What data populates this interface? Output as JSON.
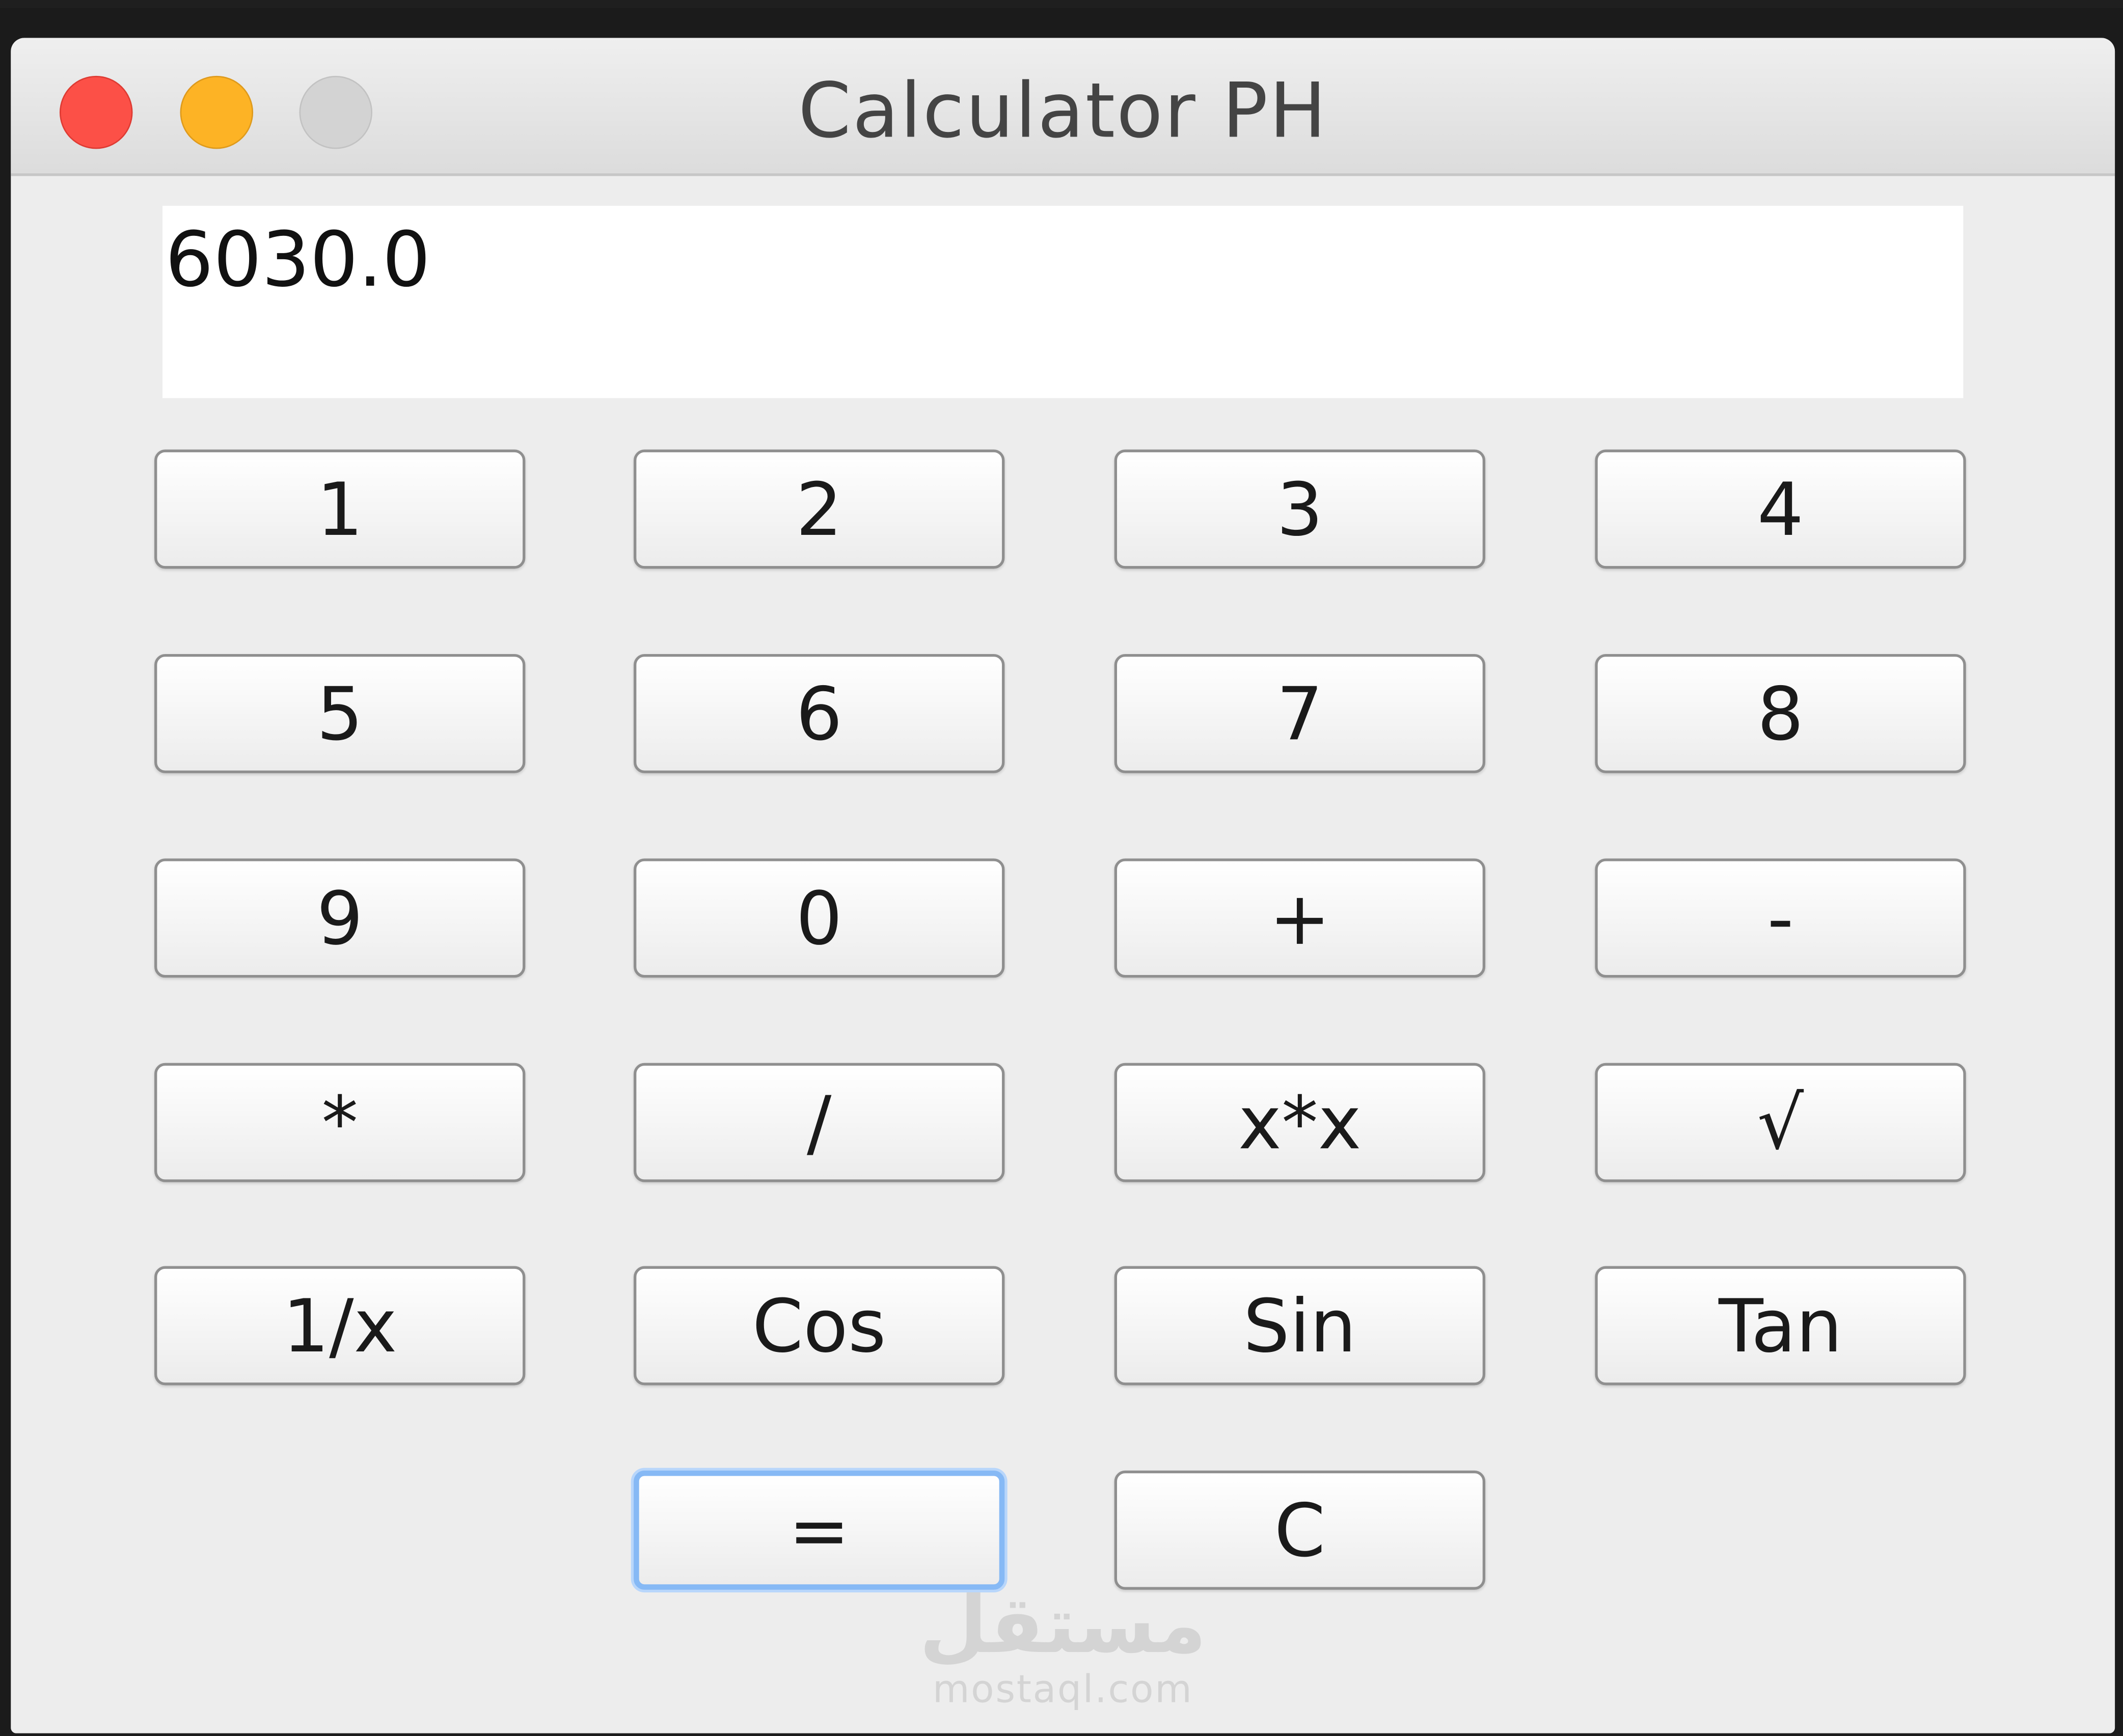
{
  "window": {
    "title": "Calculator PH"
  },
  "display": {
    "value": "6030.0"
  },
  "buttons": {
    "one": "1",
    "two": "2",
    "three": "3",
    "four": "4",
    "five": "5",
    "six": "6",
    "seven": "7",
    "eight": "8",
    "nine": "9",
    "zero": "0",
    "plus": "+",
    "minus": "-",
    "multiply": "*",
    "divide": "/",
    "square": "x*x",
    "sqrt": "√",
    "reciprocal": "1/x",
    "cos": "Cos",
    "sin": "Sin",
    "tan": "Tan",
    "equals": "=",
    "clear": "C"
  },
  "watermark": {
    "arabic": "مستقل",
    "latin": "mostaql.com"
  },
  "colors": {
    "close": "#fc5047",
    "minimize": "#fdb325",
    "zoom": "#d3d3d3",
    "focus_ring": "#86b9f5"
  }
}
